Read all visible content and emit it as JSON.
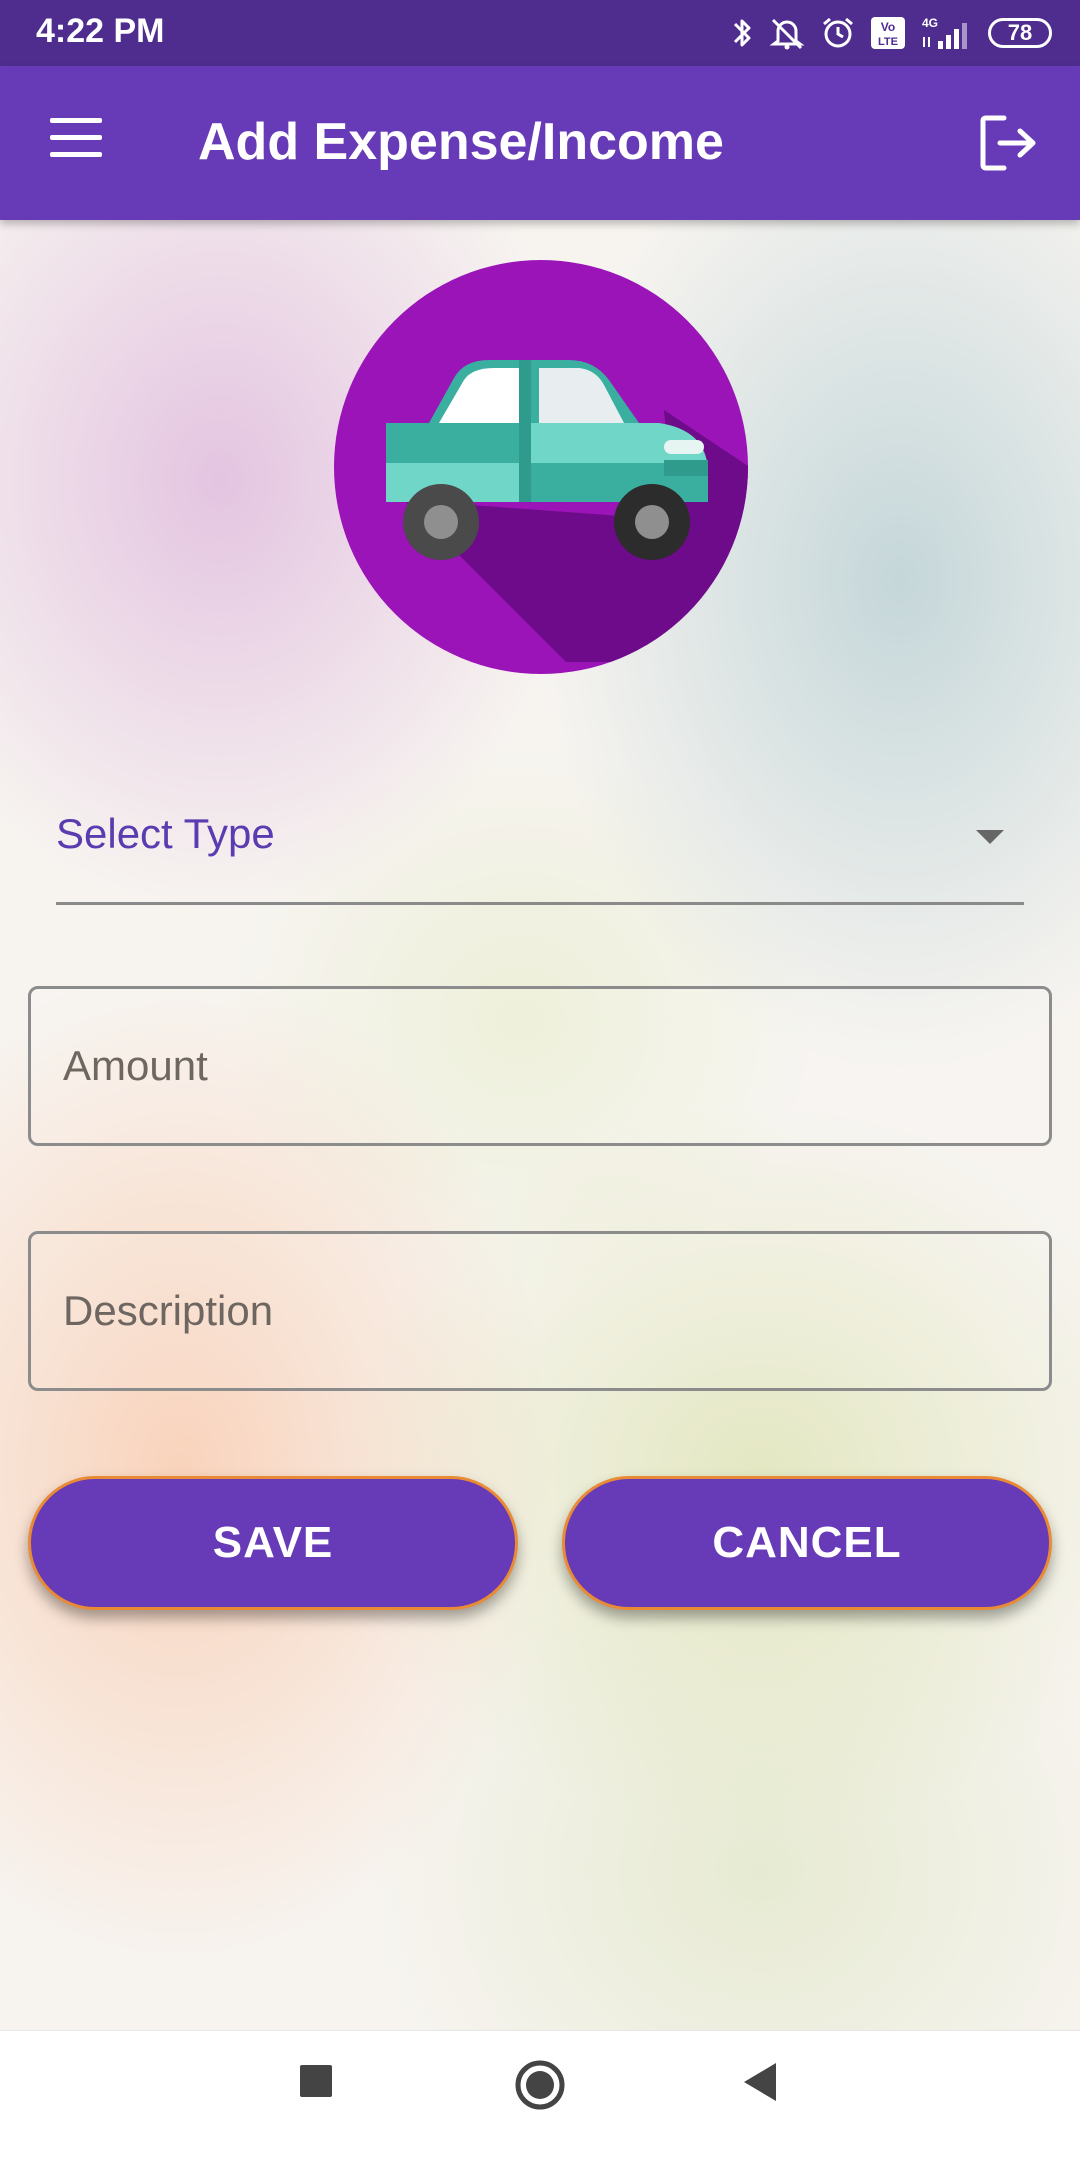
{
  "status_bar": {
    "time": "4:22 PM",
    "network": "4G",
    "volte": "Vo LTE",
    "battery": "78",
    "icons": [
      "bluetooth-icon",
      "mute-icon",
      "alarm-icon",
      "volte-icon",
      "signal-icon",
      "battery-icon"
    ]
  },
  "app_bar": {
    "title": "Add Expense/Income",
    "menu_icon": "hamburger-menu-icon",
    "logout_icon": "logout-icon",
    "color": "#673ab7"
  },
  "category_icon": "car-icon",
  "select": {
    "label": "Select Type"
  },
  "fields": {
    "amount_placeholder": "Amount",
    "amount_value": "",
    "description_placeholder": "Description",
    "description_value": ""
  },
  "buttons": {
    "save": "SAVE",
    "cancel": "CANCEL",
    "accent_border": "#e98a34"
  },
  "nav_bar": {
    "items": [
      "recents-icon",
      "home-icon",
      "back-icon"
    ]
  }
}
